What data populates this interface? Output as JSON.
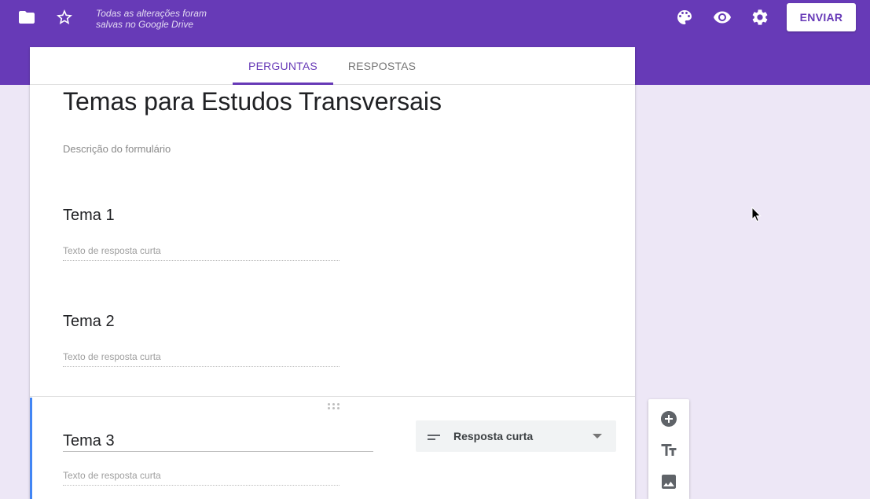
{
  "header": {
    "icons": [
      "folder-icon",
      "star-icon",
      "palette-icon",
      "eye-icon",
      "gear-icon"
    ],
    "save_status_line1": "Todas as alterações foram",
    "save_status_line2": "salvas no Google Drive",
    "send_label": "ENVIAR"
  },
  "tabs": [
    {
      "label": "PERGUNTAS",
      "active": true
    },
    {
      "label": "RESPOSTAS",
      "active": false
    }
  ],
  "form": {
    "title": "Temas para Estudos Transversais",
    "description_placeholder": "Descrição do formulário",
    "questions": [
      {
        "title": "Tema 1",
        "answer_placeholder": "Texto de resposta curta"
      },
      {
        "title": "Tema 2",
        "answer_placeholder": "Texto de resposta curta"
      },
      {
        "title": "Tema 3",
        "answer_placeholder": "Texto de resposta curta",
        "type_label": "Resposta curta"
      }
    ]
  },
  "side_toolbar": {
    "icons": [
      "add-circle-icon",
      "title-text-icon",
      "image-icon"
    ]
  },
  "colors": {
    "brand": "#673ab7",
    "background": "#ede7f6",
    "active_card_accent": "#4285f4"
  }
}
